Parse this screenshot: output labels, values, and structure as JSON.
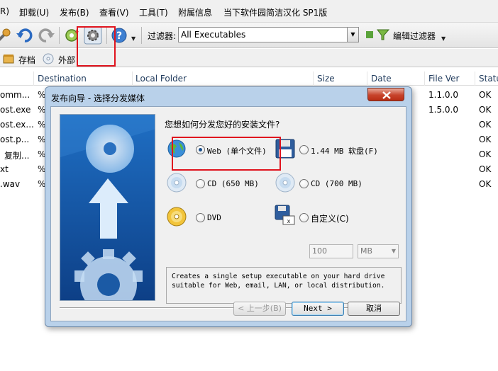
{
  "menubar": {
    "items": [
      "R)",
      "卸载(U)",
      "发布(B)",
      "查看(V)",
      "工具(T)",
      "附属信息",
      "当下软件园简洁汉化 SP1版"
    ]
  },
  "toolbar": {
    "filter_label": "过滤器:",
    "filter_value": "All Executables",
    "edit_filter_label": "编辑过滤器",
    "icons": [
      "tool-icon",
      "undo-icon",
      "redo-icon",
      "build-settings-icon",
      "settings-gear-icon",
      "help-icon"
    ]
  },
  "tabs": [
    {
      "label": "存档",
      "icon": "archive-icon"
    },
    {
      "label": "外部",
      "icon": "cd-icon"
    }
  ],
  "file_list": {
    "columns": [
      "Destination",
      "Local Folder",
      "Size",
      "Date",
      "File Ver",
      "Statu"
    ],
    "rows": [
      {
        "name": "omm...",
        "dest": "%",
        "ver": "1.1.0.0",
        "status": "OK"
      },
      {
        "name": "ost.exe",
        "dest": "%",
        "ver": "1.5.0.0",
        "status": "OK"
      },
      {
        "name": "ost.ex...",
        "dest": "%",
        "ver": "",
        "status": "OK"
      },
      {
        "name": "ost.p...",
        "dest": "%",
        "ver": "",
        "status": "OK"
      },
      {
        "name": "复制...",
        "dest": "%",
        "ver": "",
        "status": "OK"
      },
      {
        "name": "xt",
        "dest": "%",
        "ver": "",
        "status": "OK"
      },
      {
        "name": ".wav",
        "dest": "%",
        "ver": "",
        "status": "OK"
      }
    ]
  },
  "dialog": {
    "title": "发布向导 - 选择分发媒体",
    "question": "您想如何分发您好的安装文件?",
    "options": {
      "web": {
        "label": "Web (单个文件)",
        "selected": true,
        "icon": "globe-icon"
      },
      "floppy": {
        "label": "1.44 MB 软盘(F)",
        "selected": false,
        "icon": "floppy-icon"
      },
      "cd650": {
        "label": "CD (650 MB)",
        "selected": false,
        "icon": "cd-icon"
      },
      "cd700": {
        "label": "CD (700 MB)",
        "selected": false,
        "icon": "cd-icon"
      },
      "dvd": {
        "label": "DVD",
        "selected": false,
        "icon": "dvd-icon"
      },
      "custom": {
        "label": "自定义(C)",
        "selected": false,
        "icon": "custom-media-icon"
      }
    },
    "custom_size": "100",
    "custom_unit": "MB",
    "description": "Creates a single setup executable on your hard drive suitable for Web, email, LAN, or local distribution.",
    "buttons": {
      "back": "< 上一步(B)",
      "next": "Next >",
      "cancel": "取消"
    }
  },
  "colors": {
    "highlight_box": "#e0141e",
    "dialog_frame": "#b9d1ea",
    "close_button": "#c7432b",
    "selected_radio": "#1a4f8c"
  }
}
